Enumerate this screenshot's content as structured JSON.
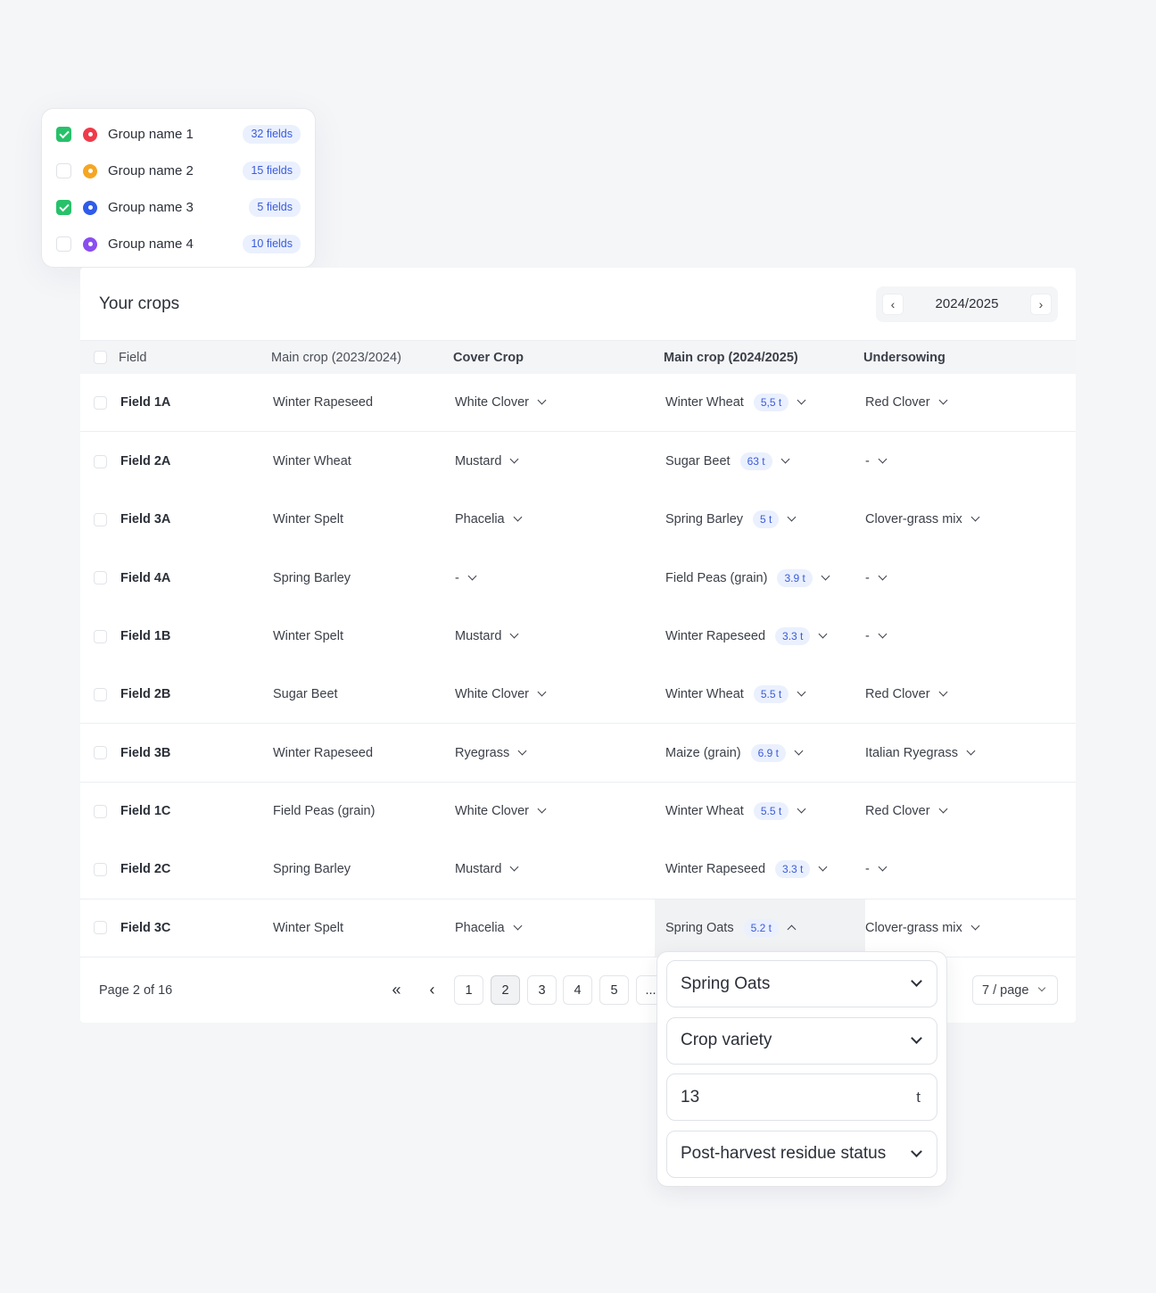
{
  "groups": [
    {
      "name": "Group name 1",
      "count": "32 fields",
      "checked": true,
      "color": "#ef3b4a"
    },
    {
      "name": "Group name 2",
      "count": "15 fields",
      "checked": false,
      "color": "#f5a623"
    },
    {
      "name": "Group name 3",
      "count": "5 fields",
      "checked": true,
      "color": "#2f5bea"
    },
    {
      "name": "Group name 4",
      "count": "10 fields",
      "checked": false,
      "color": "#8a4ef0"
    }
  ],
  "card": {
    "title": "Your crops",
    "season": "2024/2025"
  },
  "table": {
    "headers": {
      "field": "Field",
      "main_prev": "Main crop (2023/2024)",
      "cover": "Cover Crop",
      "main_curr": "Main crop (2024/2025)",
      "under": "Undersowing"
    },
    "rows": [
      {
        "field": "Field 1A",
        "main_prev": "Winter Rapeseed",
        "cover": "White Clover",
        "main_curr": "Winter Wheat",
        "yield": "5,5 t",
        "under": "Red Clover"
      },
      {
        "field": "Field 2A",
        "main_prev": "Winter Wheat",
        "cover": "Mustard",
        "main_curr": "Sugar Beet",
        "yield": "63 t",
        "under": "-"
      },
      {
        "field": "Field 3A",
        "main_prev": "Winter Spelt",
        "cover": "Phacelia",
        "main_curr": "Spring Barley",
        "yield": "5 t",
        "under": "Clover-grass mix"
      },
      {
        "field": "Field 4A",
        "main_prev": "Spring Barley",
        "cover": "-",
        "main_curr": "Field Peas (grain)",
        "yield": "3.9 t",
        "under": "-"
      },
      {
        "field": "Field 1B",
        "main_prev": "Winter Spelt",
        "cover": "Mustard",
        "main_curr": "Winter Rapeseed",
        "yield": "3.3 t",
        "under": "-"
      },
      {
        "field": "Field 2B",
        "main_prev": "Sugar Beet",
        "cover": "White Clover",
        "main_curr": "Winter Wheat",
        "yield": "5.5 t",
        "under": "Red Clover"
      },
      {
        "field": "Field 3B",
        "main_prev": "Winter Rapeseed",
        "cover": "Ryegrass",
        "main_curr": "Maize (grain)",
        "yield": "6.9 t",
        "under": "Italian Ryegrass"
      },
      {
        "field": "Field 1C",
        "main_prev": "Field Peas (grain)",
        "cover": "White Clover",
        "main_curr": "Winter Wheat",
        "yield": "5.5 t",
        "under": "Red Clover"
      },
      {
        "field": "Field 2C",
        "main_prev": "Spring Barley",
        "cover": "Mustard",
        "main_curr": "Winter Rapeseed",
        "yield": "3.3 t",
        "under": "-"
      },
      {
        "field": "Field 3C",
        "main_prev": "Winter Spelt",
        "cover": "Phacelia",
        "main_curr": "Spring Oats",
        "yield": "5.2 t",
        "under": "Clover-grass mix"
      }
    ]
  },
  "pagination": {
    "label": "Page 2 of 16",
    "pages": [
      "1",
      "2",
      "3",
      "4",
      "5",
      "..."
    ],
    "current": "2",
    "per_page": "7 / page"
  },
  "popover": {
    "crop": "Spring Oats",
    "variety_placeholder": "Crop variety",
    "yield_value": "13",
    "yield_unit": "t",
    "residue_placeholder": "Post-harvest residue status"
  }
}
